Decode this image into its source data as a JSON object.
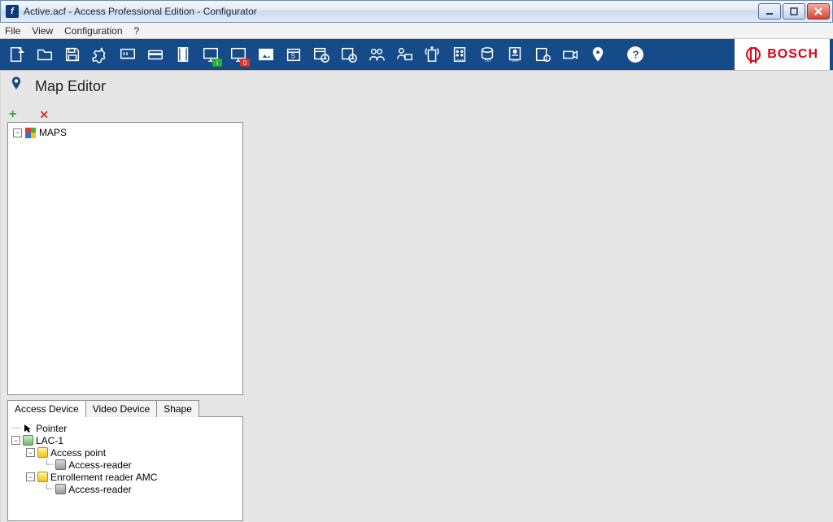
{
  "window": {
    "title": "Active.acf - Access Professional Edition - Configurator"
  },
  "menu": {
    "file": "File",
    "view": "View",
    "configuration": "Configuration",
    "help": "?"
  },
  "toolbar": {
    "badge_info": "i",
    "badge_zero": "0",
    "brand": "BOSCH"
  },
  "section": {
    "title": "Map Editor"
  },
  "maps_tree": {
    "root_label": "MAPS"
  },
  "tabs": {
    "access_device": "Access Device",
    "video_device": "Video Device",
    "shape": "Shape"
  },
  "device_tree": {
    "pointer": "Pointer",
    "lac": "LAC-1",
    "access_point": "Access point",
    "access_reader1": "Access-reader",
    "enrollment_reader": "Enrollement reader AMC",
    "access_reader2": "Access-reader"
  }
}
